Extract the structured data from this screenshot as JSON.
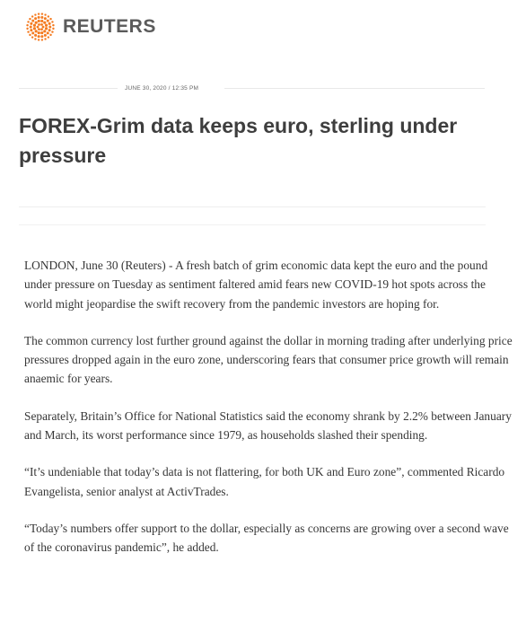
{
  "brand": {
    "name": "REUTERS",
    "accent_color": "#f47b20",
    "logo_icon": "reuters-dot-circle-icon"
  },
  "article": {
    "dateline": "JUNE 30, 2020 / 12:35 PM",
    "headline": "FOREX-Grim data keeps euro, sterling under pressure",
    "paragraphs": [
      "LONDON, June 30 (Reuters) - A fresh batch of grim economic data kept the euro and the pound under pressure on Tuesday as sentiment faltered amid fears new COVID-19 hot spots across the world might jeopardise the swift recovery from the pandemic investors are hoping for.",
      "The common currency lost further ground against the dollar in morning trading after underlying price pressures dropped again in the euro zone, underscoring fears that consumer price growth will remain anaemic for years.",
      "Separately, Britain’s Office for National Statistics said the economy shrank by 2.2% between January and March, its worst performance since 1979, as households slashed their spending.",
      "“It’s undeniable that today’s data is not flattering, for both UK and Euro zone”, commented Ricardo Evangelista, senior analyst at ActivTrades.",
      "“Today’s numbers offer support to the dollar, especially as concerns are growing over a second wave of the coronavirus pandemic”, he added."
    ]
  }
}
